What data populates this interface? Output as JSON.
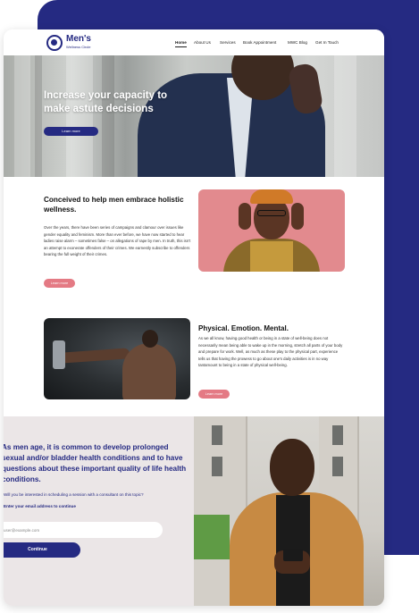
{
  "brand": {
    "name": "Men's",
    "tagline": "Wellness Circle",
    "primary_color": "#252a82",
    "accent_color": "#e47a84"
  },
  "nav": {
    "items": [
      {
        "label": "Home",
        "active": true
      },
      {
        "label": "About Us",
        "active": false
      },
      {
        "label": "Services",
        "active": false
      },
      {
        "label": "Book Appointment",
        "active": false
      },
      {
        "label": "MWC Blog",
        "active": false
      },
      {
        "label": "Get In Touch",
        "active": false
      }
    ]
  },
  "hero": {
    "title": "Increase your capacity to make astute decisions",
    "button": "Learn more"
  },
  "holistic": {
    "title": "Conceived to help men embrace holistic wellness.",
    "body": "Over the years, there have been series of campaigns and clamour over issues like gender equality and feminism. More than ever before, we have now started to hear ladies raise alarm – sometimes false – on allegations of rape by men. In truth, this isn't an attempt to exonerate offenders of their crimes. We earnestly subscribe to offenders bearing the full weight of their crimes.",
    "button": "Learn more"
  },
  "physical": {
    "title": "Physical. Emotion. Mental.",
    "body": "As we all know, having good health or being in a state of well-being does not necessarily mean being able to wake up in the morning, stretch all parts of your body and prepare for work. Well, as much as these play to the physical part, experience tells us that having the prowess to go about one's daily activities is in no way tantamount to being in a state of physical well-being.",
    "button": "Learn more"
  },
  "consult": {
    "title": "As men age, it is common to develop prolonged sexual and/or bladder health conditions and to have questions about these important quality of life health conditions.",
    "question": "Will you be interested in scheduling a session with a consultant on this topic?",
    "email_label": "Enter your email address to continue",
    "email_placeholder": "user@example.com",
    "button": "Continue"
  }
}
